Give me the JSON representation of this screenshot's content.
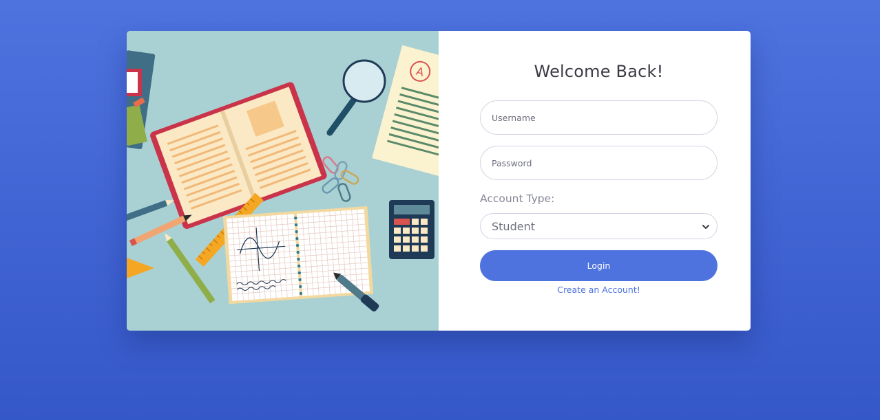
{
  "login_card": {
    "title": "Welcome Back!",
    "username": {
      "placeholder": "Username",
      "value": ""
    },
    "password": {
      "placeholder": "Password",
      "value": ""
    },
    "account_type": {
      "label": "Account Type:",
      "selected": "Student",
      "icon": "chevron-down-icon"
    },
    "login_button_label": "Login",
    "create_account_link": "Create an Account!"
  },
  "illustration": {
    "description_icon": "study-desk-illustration",
    "grade_mark": "A",
    "colors": {
      "background": "#a9d1d3",
      "book_cover": "#c9344a",
      "page": "#fbe8c4",
      "ruler": "#f5a623",
      "calculator": "#1f3a56"
    }
  },
  "colors": {
    "page_background": "#4e73df",
    "primary": "#4e73df",
    "title_text": "#3a3b45",
    "muted_text": "#858796",
    "input_border": "#d1d3e2"
  }
}
